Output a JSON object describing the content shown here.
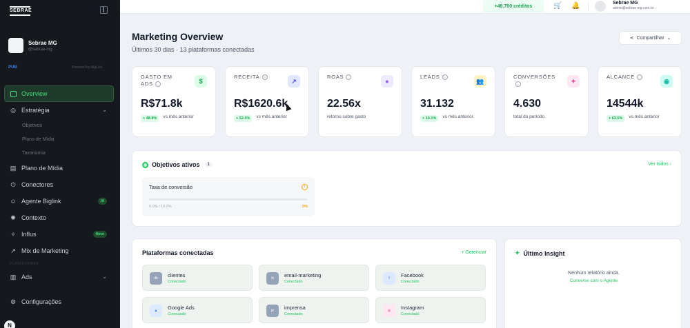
{
  "sidebar": {
    "logo": "SEBRAE",
    "org": {
      "name": "Sebrae MG",
      "handle": "@sebrae-mg"
    },
    "plan": "PUB",
    "plan_right": "Powered by BigLink",
    "items": [
      {
        "label": "Overview",
        "icon": "grid-icon",
        "active": true
      },
      {
        "label": "Estratégia",
        "icon": "target-icon"
      },
      {
        "label": "Objetivos"
      },
      {
        "label": "Plano de Mídia"
      },
      {
        "label": "Taxonomia"
      },
      {
        "label": "Plano de Mídia",
        "icon": "document-icon"
      },
      {
        "label": "Conectores",
        "icon": "plug-icon"
      },
      {
        "label": "Agente Biglink",
        "icon": "bot-icon",
        "badge": "IA"
      },
      {
        "label": "Contexto",
        "icon": "brain-icon"
      },
      {
        "label": "Influs",
        "icon": "star-icon",
        "badge": "Novo"
      },
      {
        "label": "Mix de Marketing",
        "icon": "trend-icon"
      },
      {
        "label": "PLATAFORMAS"
      },
      {
        "label": "Ads",
        "icon": "ads-icon"
      },
      {
        "label": "Configurações",
        "icon": "gear-icon"
      }
    ],
    "bottom_avatar": "N"
  },
  "topbar": {
    "credits": "+49.700 créditos",
    "user_name": "Sebrae MG",
    "user_email": "admin@sebrae-mg.com.br"
  },
  "header": {
    "title": "Marketing Overview",
    "subtitle": "Últimos 30 dias · 13 plataformas conectadas",
    "share": "Compartilhar"
  },
  "kpis": [
    {
      "label": "GASTO EM ADS",
      "value": "R$71.8k",
      "trend": "+ 48.8%",
      "note": "vs mês anterior",
      "icon": "$",
      "icon_bg": "#dcfce7",
      "icon_color": "#16a34a"
    },
    {
      "label": "RECEITA",
      "value": "R$1620.6k",
      "trend": "+ 52.3%",
      "note": "vs mês anterior",
      "icon": "↗",
      "icon_bg": "#e0e7ff",
      "icon_color": "#4f46e5"
    },
    {
      "label": "ROAS",
      "value": "22.56x",
      "trend": "",
      "note": "retorno sobre gasto",
      "icon": "●",
      "icon_bg": "#ede9fe",
      "icon_color": "#8b5cf6"
    },
    {
      "label": "LEADS",
      "value": "31.132",
      "trend": "+ 10.1%",
      "note": "vs mês anterior",
      "icon": "👥",
      "icon_bg": "#fef3c7",
      "icon_color": "#f59e0b"
    },
    {
      "label": "CONVERSÕES",
      "value": "4.630",
      "trend": "",
      "note": "total do período",
      "icon": "✦",
      "icon_bg": "#fce7f3",
      "icon_color": "#ec4899"
    },
    {
      "label": "ALCANCE",
      "value": "14544k",
      "trend": "+ 63.5%",
      "note": "vs mês anterior",
      "icon": "◉",
      "icon_bg": "#ccfbf1",
      "icon_color": "#14b8a6"
    }
  ],
  "objetivos": {
    "title": "Objetivos ativos",
    "count": "1",
    "link": "Ver todos ›",
    "goal": {
      "name": "Taxa de conversão",
      "left": "0.0% / 10.0%",
      "right": "0%",
      "progress": 0
    }
  },
  "plataformas": {
    "title": "Plataformas conectadas",
    "link": "+ Gerenciar",
    "items": [
      {
        "name": "clientes",
        "status": "Conectado",
        "icon": "db",
        "icon_bg": "#94a3b8"
      },
      {
        "name": "email-marketing",
        "status": "Conectado",
        "icon": "✉",
        "icon_bg": "#94a3b8"
      },
      {
        "name": "Facebook",
        "status": "Conectado",
        "icon": "f",
        "icon_bg": "#dbeafe",
        "icon_color": "#2563eb"
      },
      {
        "name": "Google Ads",
        "status": "Conectado",
        "icon": "▲",
        "icon_bg": "#dbeafe",
        "icon_color": "#2563eb"
      },
      {
        "name": "imprensa",
        "status": "Conectado",
        "icon": "pr",
        "icon_bg": "#94a3b8"
      },
      {
        "name": "Instagram",
        "status": "Conectado",
        "icon": "◎",
        "icon_bg": "#fce7f3",
        "icon_color": "#db2777"
      }
    ]
  },
  "insight": {
    "title": "Último Insight",
    "empty": "Nenhum relatório ainda.",
    "link": "Converse com o Agente"
  }
}
